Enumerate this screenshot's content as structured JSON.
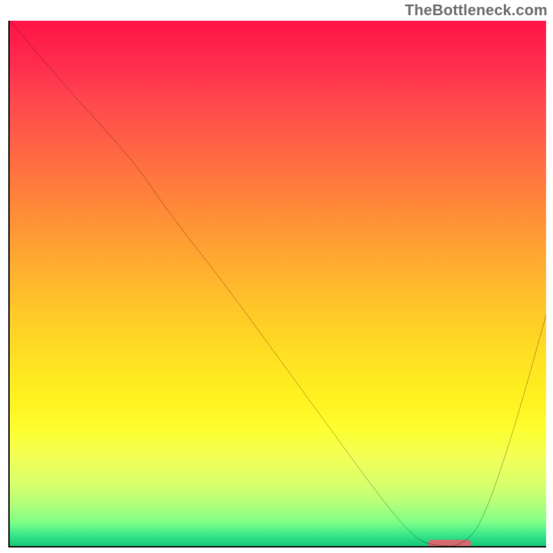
{
  "watermark": "TheBottleneck.com",
  "chart_data": {
    "type": "line",
    "title": "",
    "xlabel": "",
    "ylabel": "",
    "xlim": [
      0,
      100
    ],
    "ylim": [
      0,
      100
    ],
    "grid": false,
    "series": [
      {
        "name": "curve",
        "x": [
          0,
          10,
          18,
          24,
          30,
          40,
          50,
          60,
          70,
          76,
          80,
          84,
          88,
          94,
          100
        ],
        "y": [
          100,
          88,
          79,
          72,
          63,
          50,
          36,
          22,
          8,
          1,
          0,
          0,
          4,
          22,
          44
        ]
      }
    ],
    "marker": {
      "x_center": 82,
      "y_center": 0.5,
      "width": 8,
      "height": 1.4,
      "color": "#d46a6e"
    },
    "gradient_stops": [
      {
        "pos": 0.0,
        "color": "#ff1446"
      },
      {
        "pos": 0.08,
        "color": "#ff2b4e"
      },
      {
        "pos": 0.16,
        "color": "#ff4a4e"
      },
      {
        "pos": 0.26,
        "color": "#ff6a42"
      },
      {
        "pos": 0.36,
        "color": "#ff8a38"
      },
      {
        "pos": 0.46,
        "color": "#ffab30"
      },
      {
        "pos": 0.55,
        "color": "#ffc728"
      },
      {
        "pos": 0.64,
        "color": "#ffe022"
      },
      {
        "pos": 0.72,
        "color": "#fff21f"
      },
      {
        "pos": 0.78,
        "color": "#fdff30"
      },
      {
        "pos": 0.83,
        "color": "#f2ff56"
      },
      {
        "pos": 0.88,
        "color": "#d9ff6a"
      },
      {
        "pos": 0.92,
        "color": "#b3ff7a"
      },
      {
        "pos": 0.955,
        "color": "#7dff88"
      },
      {
        "pos": 0.98,
        "color": "#36e68a"
      },
      {
        "pos": 1.0,
        "color": "#14c578"
      }
    ]
  }
}
